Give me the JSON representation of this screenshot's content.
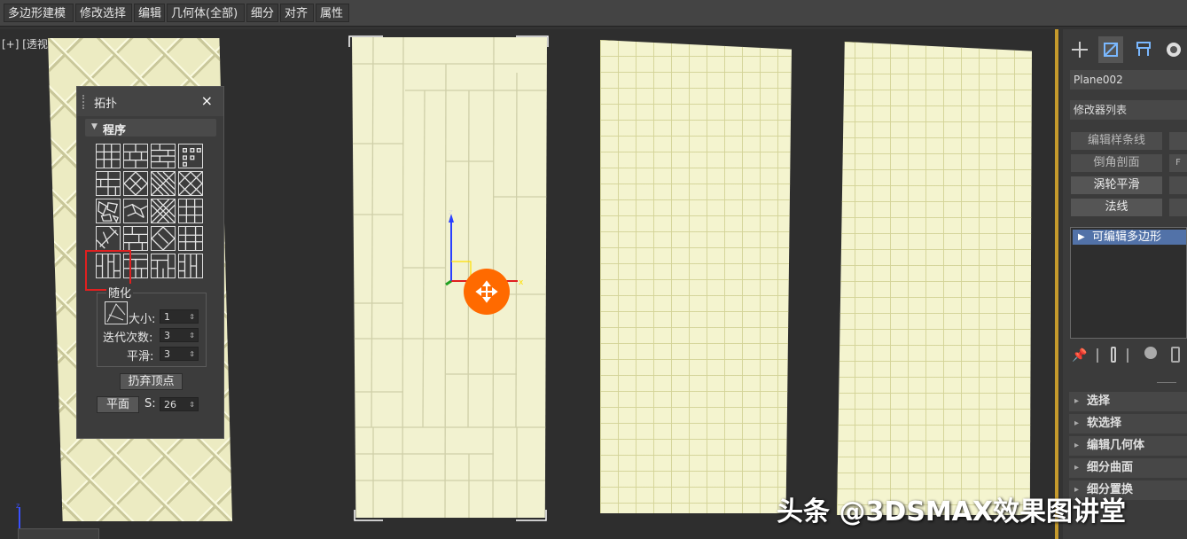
{
  "menubar": {
    "items": [
      "多边形建模",
      "修改选择",
      "编辑",
      "几何体(全部)",
      "细分",
      "对齐",
      "属性"
    ]
  },
  "viewport": {
    "label": "[+] [透视] [标准] [边面]",
    "axis_z": "z",
    "axis_x": "x"
  },
  "topology_panel": {
    "title": "拓扑",
    "close": "×",
    "section": "程序",
    "subsection": "随化",
    "size_label": "大小:",
    "size_value": "1",
    "iterations_label": "迭代次数:",
    "iterations_value": "3",
    "smooth_label": "平滑:",
    "smooth_value": "3",
    "discard_button": "扔弃顶点",
    "plane_button": "平面",
    "s_label": "S:",
    "s_value": "26"
  },
  "command_panel": {
    "object_name": "Plane002",
    "modifier_list": "修改器列表",
    "buttons": [
      "编辑样条线",
      "倒角剖面",
      "涡轮平滑",
      "法线"
    ],
    "stack_item": "可编辑多边形",
    "rollouts": [
      "选择",
      "软选择",
      "编辑几何体",
      "细分曲面",
      "细分置换"
    ]
  },
  "watermark": "头条 @3DSMAX效果图讲堂",
  "colors": {
    "background": "#2e2e2e",
    "plane": "#f4f4cf",
    "gizmo": "#ff6a00",
    "highlight_box": "#e02020",
    "viewport_border": "#c59a2c",
    "stack_selected": "#5272a8"
  }
}
